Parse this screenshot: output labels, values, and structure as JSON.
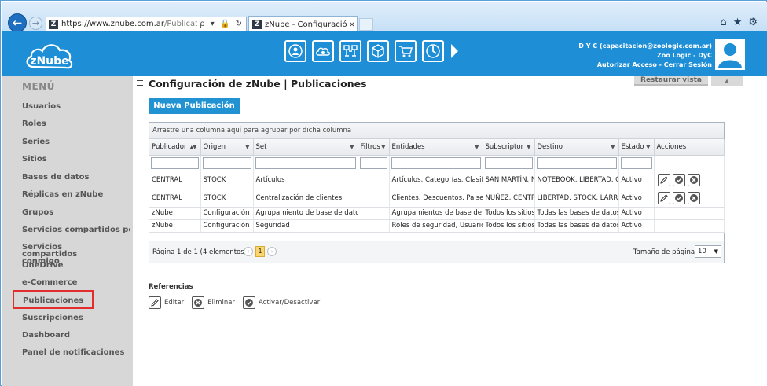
{
  "browser": {
    "url_host": "https://www.znube.com.ar",
    "url_path": "/Publication/ObjectPubl",
    "addr_icons": "ρ ▾ 🔒 ↻",
    "tab_title": "zNube - Configuración de z...",
    "tab_close": "×"
  },
  "app": {
    "logo_text": "zNube",
    "user_line1": "D Y C (capacitacion@zoologic.com.ar)",
    "user_line2": "Zoo Logic - DyC",
    "user_line3": "Autorizar Acceso - Cerrar Sesión"
  },
  "sidebar": {
    "title": "MENÚ",
    "items": [
      {
        "label": "Usuarios"
      },
      {
        "label": "Roles"
      },
      {
        "label": "Series"
      },
      {
        "label": "Sitios"
      },
      {
        "label": "Bases de datos"
      },
      {
        "label": "Réplicas en zNube"
      },
      {
        "label": "Grupos"
      },
      {
        "label": "Servicios compartidos por mi"
      },
      {
        "label": "Servicios compartidos conmigo"
      },
      {
        "label": "OneDrive"
      },
      {
        "label": "e-Commerce"
      },
      {
        "label": "Publicaciones"
      },
      {
        "label": "Suscripciones"
      },
      {
        "label": "Dashboard"
      },
      {
        "label": "Panel de notificaciones"
      }
    ]
  },
  "main": {
    "title": "Configuración de zNube | Publicaciones",
    "restore_label": "Restaurar vista",
    "new_button": "Nueva Publicación",
    "group_hint": "Arrastre una columna aquí para agrupar por dicha columna",
    "columns": [
      "Publicador",
      "Origen",
      "Set",
      "Filtros",
      "Entidades",
      "Subscriptor",
      "Destino",
      "Estado",
      "Acciones"
    ],
    "rows": [
      {
        "publicador": "CENTRAL",
        "origen": "STOCK",
        "set": "Artículos",
        "filtros": "",
        "entidades": "Artículos, Categorías, Clasifica",
        "subscriptor": "SAN MARTÍN, N",
        "destino": "NOTEBOOK, LIBERTAD, GU",
        "estado": "Activo",
        "actions": true
      },
      {
        "publicador": "CENTRAL",
        "origen": "STOCK",
        "set": "Centralización de clientes",
        "filtros": "",
        "entidades": "Clientes, Descuentos, Paises, ",
        "subscriptor": "NUÑEZ, CENTR",
        "destino": "LIBERTAD, STOCK, LARRA",
        "estado": "Activo",
        "actions": true
      },
      {
        "publicador": "zNube",
        "origen": "Configuración",
        "set": "Agrupamiento de base de datos",
        "filtros": "",
        "entidades": "Agrupamientos de base de da",
        "subscriptor": "Todos los sitios",
        "destino": "Todas las bases de datos",
        "estado": "Activo",
        "actions": false
      },
      {
        "publicador": "zNube",
        "origen": "Configuración",
        "set": "Seguridad",
        "filtros": "",
        "entidades": "Roles de seguridad, Usuarios",
        "subscriptor": "Todos los sitios",
        "destino": "Todas las bases de datos",
        "estado": "Activo",
        "actions": false
      }
    ],
    "pager": {
      "info": "Página 1 de 1 (4 elementos)",
      "current_page": "1",
      "size_label": "Tamaño de página:",
      "size_value": "10"
    },
    "references": {
      "title": "Referencias",
      "edit": "Editar",
      "delete": "Eliminar",
      "toggle": "Activar/Desactivar"
    }
  }
}
